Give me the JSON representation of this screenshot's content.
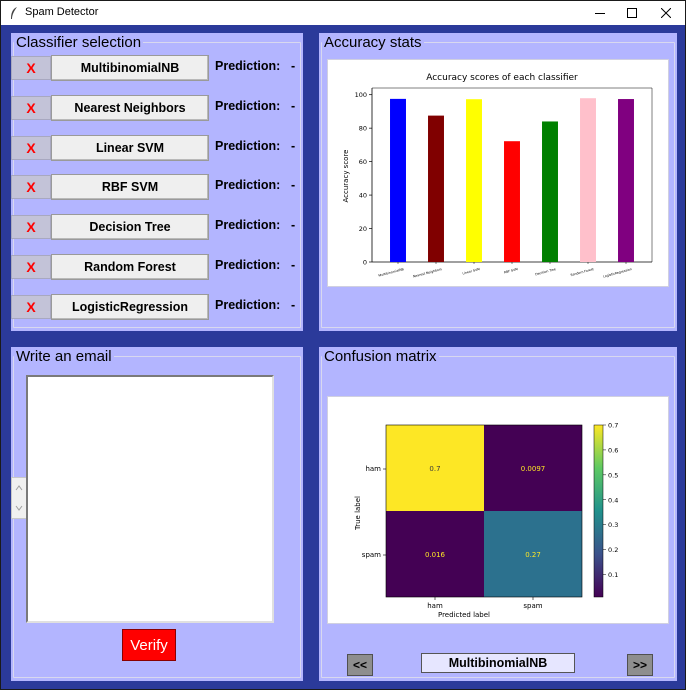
{
  "window": {
    "title": "Spam Detector",
    "controls": {
      "minimize": "—",
      "maximize": "☐",
      "close": "✕"
    }
  },
  "classifier_selection": {
    "title": "Classifier selection",
    "remove_label": "X",
    "prediction_label": "Prediction:",
    "rows": [
      {
        "name": "MultibinomialNB",
        "prediction": "-"
      },
      {
        "name": "Nearest Neighbors",
        "prediction": "-"
      },
      {
        "name": "Linear SVM",
        "prediction": "-"
      },
      {
        "name": "RBF SVM",
        "prediction": "-"
      },
      {
        "name": "Decision Tree",
        "prediction": "-"
      },
      {
        "name": "Random Forest",
        "prediction": "-"
      },
      {
        "name": "LogisticRegression",
        "prediction": "-"
      }
    ]
  },
  "accuracy_stats": {
    "title": "Accuracy stats"
  },
  "email": {
    "title": "Write an email",
    "value": "",
    "verify_label": "Verify"
  },
  "confusion_panel": {
    "title": "Confusion matrix",
    "prev_label": "<<",
    "next_label": ">>",
    "current_model": "MultibinomialNB"
  },
  "chart_data": [
    {
      "type": "bar",
      "title": "Accuracy scores of each classifier",
      "xlabel": "",
      "ylabel": "Accuracy score",
      "categories": [
        "MultibinomialNB",
        "Nearest Neighbors",
        "Linear SVM",
        "RBF SVM",
        "Decision Tree",
        "Random Forest",
        "LogisticRegression"
      ],
      "values": [
        97.5,
        87.5,
        97.3,
        72.2,
        84.0,
        97.9,
        97.4
      ],
      "colors": [
        "#0000ff",
        "#800000",
        "#ffff00",
        "#ff0000",
        "#008000",
        "#ffc0cb",
        "#800080"
      ],
      "yticks": [
        "0",
        "20",
        "40",
        "60",
        "80",
        "100"
      ],
      "ylim": [
        0,
        104
      ],
      "grid": false
    },
    {
      "type": "heatmap",
      "xlabel": "Predicted label",
      "ylabel": "True label",
      "x_categories": [
        "ham",
        "spam"
      ],
      "y_categories": [
        "ham",
        "spam"
      ],
      "cells": [
        {
          "text": "0.7",
          "value": 0.7,
          "color": "#fde725",
          "text_color": "#3b3b3b"
        },
        {
          "text": "0.0097",
          "value": 0.0097,
          "color": "#440154",
          "text_color": "#fde725"
        },
        {
          "text": "0.016",
          "value": 0.016,
          "color": "#440154",
          "text_color": "#fde725"
        },
        {
          "text": "0.27",
          "value": 0.27,
          "color": "#2c718e",
          "text_color": "#fde725"
        }
      ],
      "colorbar_ticks": [
        "0.1",
        "0.2",
        "0.3",
        "0.4",
        "0.5",
        "0.6",
        "0.7"
      ],
      "colorbar_range": [
        0.0097,
        0.7
      ],
      "colormap_stops": [
        "#440154",
        "#3b528b",
        "#21918c",
        "#5ec962",
        "#fde725"
      ]
    }
  ]
}
